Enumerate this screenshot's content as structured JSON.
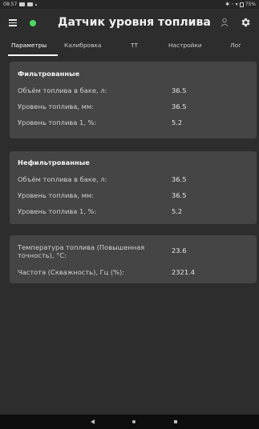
{
  "status_bar": {
    "time": "08:57",
    "battery": "75%"
  },
  "app_bar": {
    "title": "Датчик уровня топлива",
    "colors": {
      "connection": "#4cd964"
    },
    "icons": [
      "menu-icon",
      "connection-status-icon",
      "user-icon",
      "gear-icon"
    ]
  },
  "tabs": [
    {
      "label": "Параметры",
      "active": true
    },
    {
      "label": "Калибровка",
      "active": false
    },
    {
      "label": "ТТ",
      "active": false
    },
    {
      "label": "Настройки",
      "active": false
    },
    {
      "label": "Лог",
      "active": false
    }
  ],
  "filtered": {
    "title": "Фильтрованные",
    "rows": [
      {
        "label": "Объём топлива в баке, л:",
        "value": "36.5"
      },
      {
        "label": "Уровень топлива, мм:",
        "value": "36.5"
      },
      {
        "label": "Уровень топлива 1, %:",
        "value": "5.2"
      }
    ]
  },
  "unfiltered": {
    "title": "Нефильтрованные",
    "rows": [
      {
        "label": "Объём топлива в баке, л:",
        "value": "36.5"
      },
      {
        "label": "Уровень топлива, мм:",
        "value": "36.5"
      },
      {
        "label": "Уровень топлива 1, %:",
        "value": "5.2"
      }
    ]
  },
  "extra": {
    "rows": [
      {
        "label_line1": "Температура топлива (Повышенная",
        "label_line2": "точность), °C:",
        "value": "23.6"
      },
      {
        "label": "Частота (Скважность), Гц (%):",
        "value": "2321.4"
      }
    ]
  },
  "nav_bar": {
    "icons": [
      "back-icon",
      "home-icon",
      "recents-icon"
    ]
  }
}
